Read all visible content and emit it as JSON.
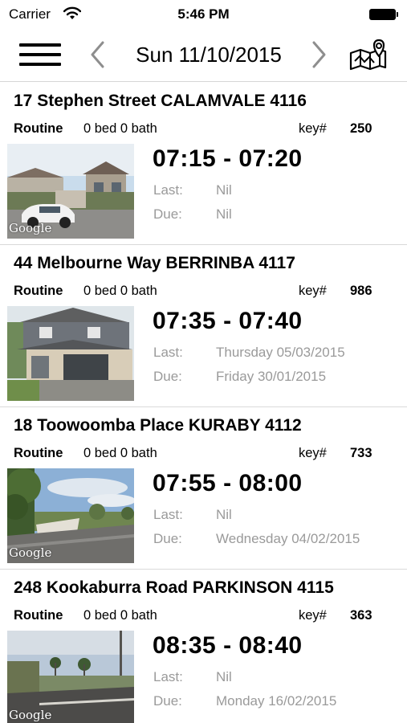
{
  "status_bar": {
    "carrier": "Carrier",
    "time": "5:46 PM"
  },
  "nav": {
    "date": "Sun 11/10/2015"
  },
  "colors": {
    "secondary_text": "#9a9a9a",
    "divider": "#d9d9d9"
  },
  "labels": {
    "last": "Last:",
    "due": "Due:",
    "key": "key#",
    "watermark": "Google"
  },
  "jobs": [
    {
      "address": "17 Stephen Street CALAMVALE 4116",
      "type": "Routine",
      "beds": "0 bed 0 bath",
      "key": "250",
      "time": "07:15 - 07:20",
      "last": "Nil",
      "due": "Nil"
    },
    {
      "address": "44 Melbourne  Way BERRINBA 4117",
      "type": "Routine",
      "beds": "0 bed 0 bath",
      "key": "986",
      "time": "07:35 - 07:40",
      "last": "Thursday 05/03/2015",
      "due": "Friday 30/01/2015"
    },
    {
      "address": "18 Toowoomba Place KURABY 4112",
      "type": "Routine",
      "beds": "0 bed 0 bath",
      "key": "733",
      "time": "07:55 - 08:00",
      "last": "Nil",
      "due": "Wednesday 04/02/2015"
    },
    {
      "address": "248 Kookaburra  Road PARKINSON 4115",
      "type": "Routine",
      "beds": "0 bed 0 bath",
      "key": "363",
      "time": "08:35 - 08:40",
      "last": "Nil",
      "due": "Monday 16/02/2015"
    }
  ]
}
